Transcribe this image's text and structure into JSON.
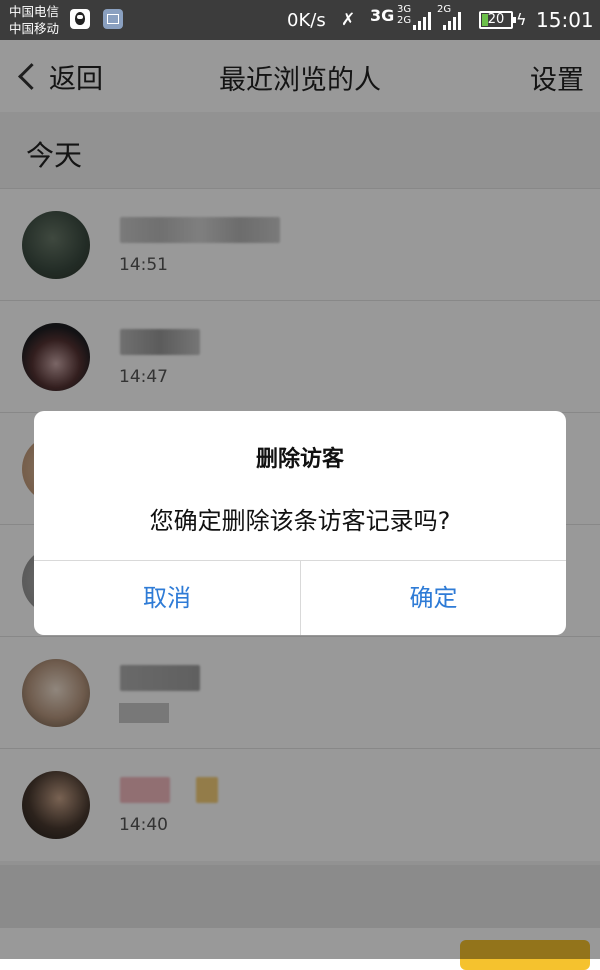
{
  "status_bar": {
    "carrier1": "中国电信",
    "carrier2": "中国移动",
    "net_speed": "0K/s",
    "net_3g": "3G",
    "net_3g_small": "3G",
    "net_2g_small": "2G",
    "net_2g": "2G",
    "battery_level": "20",
    "time": "15:01"
  },
  "nav": {
    "back_label": "返回",
    "title": "最近浏览的人",
    "settings_label": "设置"
  },
  "section": {
    "header": "今天"
  },
  "visitors": [
    {
      "time": "14:51"
    },
    {
      "time": "14:47"
    },
    {
      "time": ""
    },
    {
      "time": ""
    },
    {
      "time": ""
    },
    {
      "time": "14:40"
    }
  ],
  "dialog": {
    "title": "删除访客",
    "message": "您确定删除该条访客记录吗?",
    "cancel_label": "取消",
    "confirm_label": "确定"
  },
  "colors": {
    "accent": "#2e7bd6",
    "status_bar": "#3c3c3c"
  }
}
